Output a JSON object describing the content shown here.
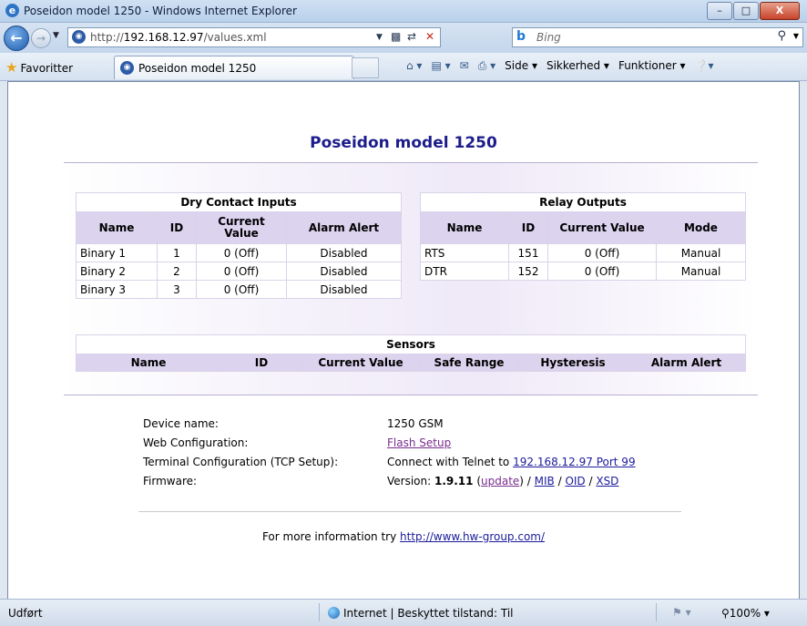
{
  "window": {
    "title": "Poseidon model 1250 - Windows Internet Explorer",
    "minimize": "–",
    "maximize": "□",
    "close": "X"
  },
  "address": {
    "url_prefix": "http://",
    "url_host": "192.168.12.97",
    "url_path": "/values.xml"
  },
  "search": {
    "placeholder": "Bing"
  },
  "favorites": {
    "label": "Favoritter"
  },
  "tab": {
    "label": "Poseidon model 1250"
  },
  "commands": {
    "page": "Side ▾",
    "safety": "Sikkerhed ▾",
    "tools": "Funktioner ▾"
  },
  "page": {
    "title": "Poseidon model 1250",
    "dry_inputs": {
      "caption": "Dry Contact Inputs",
      "headers": [
        "Name",
        "ID",
        "Current Value",
        "Alarm Alert"
      ],
      "rows": [
        [
          "Binary 1",
          "1",
          "0 (Off)",
          "Disabled"
        ],
        [
          "Binary 2",
          "2",
          "0 (Off)",
          "Disabled"
        ],
        [
          "Binary 3",
          "3",
          "0 (Off)",
          "Disabled"
        ]
      ]
    },
    "relay_outputs": {
      "caption": "Relay Outputs",
      "headers": [
        "Name",
        "ID",
        "Current Value",
        "Mode"
      ],
      "rows": [
        [
          "RTS",
          "151",
          "0 (Off)",
          "Manual"
        ],
        [
          "DTR",
          "152",
          "0 (Off)",
          "Manual"
        ]
      ]
    },
    "sensors": {
      "caption": "Sensors",
      "headers": [
        "Name",
        "ID",
        "Current Value",
        "Safe Range",
        "Hysteresis",
        "Alarm Alert"
      ]
    },
    "info": {
      "device_name_label": "Device name:",
      "device_name_value": "1250 GSM",
      "web_config_label": "Web Configuration:",
      "web_config_link": "Flash Setup",
      "terminal_label": "Terminal Configuration (TCP Setup):",
      "terminal_text": "Connect with Telnet to ",
      "terminal_link": "192.168.12.97 Port 99",
      "firmware_label": "Firmware:",
      "firmware_prefix": "Version: ",
      "firmware_version": "1.9.11",
      "firmware_open": " (",
      "update_link": "update",
      "firmware_close": ") / ",
      "mib_link": "MIB",
      "slash1": " / ",
      "oid_link": "OID",
      "slash2": " / ",
      "xsd_link": "XSD"
    },
    "more_info_text": "For more information try ",
    "more_info_link": "http://www.hw-group.com/"
  },
  "status": {
    "done": "Udført",
    "zone": "Internet | Beskyttet tilstand: Til",
    "zoom": "100%"
  }
}
